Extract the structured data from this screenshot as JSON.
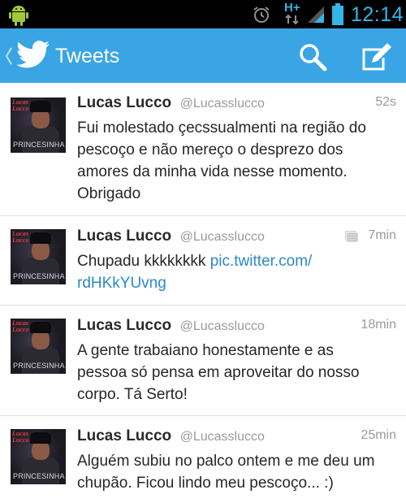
{
  "status_bar": {
    "network": "H+",
    "time": "12:14",
    "icons": [
      "android-icon",
      "alarm-icon",
      "hplus-network-icon",
      "signal-icon",
      "battery-icon"
    ]
  },
  "action_bar": {
    "title": "Tweets",
    "icons": [
      "back-chevron-icon",
      "twitter-bird-icon",
      "search-icon",
      "compose-icon"
    ],
    "color": "#3aa5e4"
  },
  "tweets": [
    {
      "author": "Lucas Lucco",
      "handle": "@Lucasslucco",
      "time": "52s",
      "text_lines": [
        "Fui molestado çecssualmenti na região do",
        "pescoço e não mereço o desprezo dos",
        "amores da minha vida nesse momento.",
        "Obrigado"
      ],
      "avatar": {
        "name_text": "Lucas Lucco",
        "caption": "PRINCESINHA"
      }
    },
    {
      "author": "Lucas Lucco",
      "handle": "@Lucasslucco",
      "time": "7min",
      "has_media": true,
      "text_prefix": "Chupadu kkkkkkkk ",
      "link_line1": "pic.twitter.com/",
      "link_line2": "rdHKkYUvng",
      "avatar": {
        "name_text": "Lucas Lucco",
        "caption": "PRINCESINHA"
      }
    },
    {
      "author": "Lucas Lucco",
      "handle": "@Lucasslucco",
      "time": "18min",
      "text_lines": [
        "A gente trabaiano honestamente e as",
        "pessoa só pensa em aproveitar do nosso",
        "corpo. Tá Serto!"
      ],
      "avatar": {
        "name_text": "Lucas Lucco",
        "caption": "PRINCESINHA"
      }
    },
    {
      "author": "Lucas Lucco",
      "handle": "@Lucasslucco",
      "time": "25min",
      "text_lines": [
        "Alguém subiu no palco ontem e me deu um",
        "chupão. Ficou lindo meu pescoço... :)"
      ],
      "avatar": {
        "name_text": "Lucas Lucco",
        "caption": "PRINCESINHA"
      }
    }
  ],
  "colors": {
    "link": "#2a89c6",
    "accent": "#33b5e5",
    "name": "#2a2a2a",
    "meta": "#9a9a9a"
  }
}
